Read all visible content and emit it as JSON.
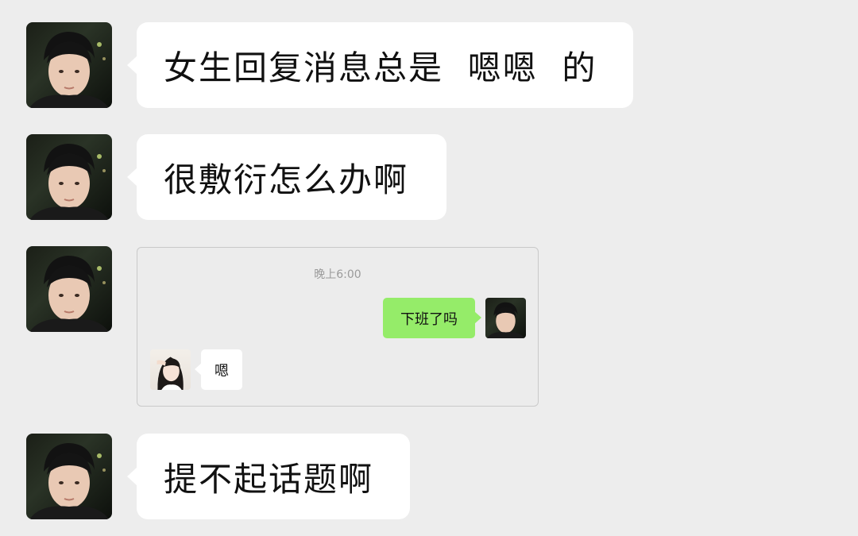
{
  "messages": [
    {
      "text": "女生回复消息总是  嗯嗯  的",
      "avatar": "boy-avatar-icon"
    },
    {
      "text": "很敷衍怎么办啊",
      "avatar": "boy-avatar-icon"
    },
    {
      "text": "提不起话题啊",
      "avatar": "boy-avatar-icon"
    }
  ],
  "embedded_chat": {
    "timestamp": "晚上6:00",
    "sent_message": "下班了吗",
    "received_message": "嗯",
    "sender_avatar": "boy-avatar-icon",
    "receiver_avatar": "girl-avatar-icon"
  },
  "colors": {
    "background": "#ededed",
    "bubble": "#ffffff",
    "sent_bubble": "#95ec69"
  }
}
